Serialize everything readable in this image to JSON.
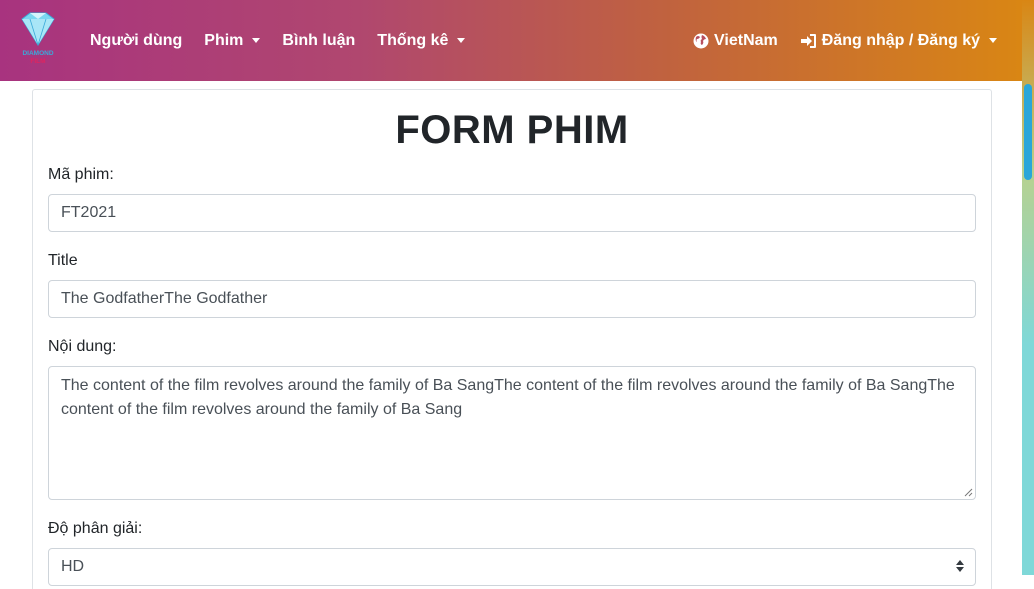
{
  "nav": {
    "logo_text": "DIAMOND FILM",
    "items": [
      {
        "label": "Người dùng",
        "dropdown": false
      },
      {
        "label": "Phim",
        "dropdown": true
      },
      {
        "label": "Bình luận",
        "dropdown": false
      },
      {
        "label": "Thống kê",
        "dropdown": true
      }
    ],
    "language": {
      "label": "VietNam",
      "icon": "globe-icon"
    },
    "auth": {
      "label": "Đăng nhập / Đăng ký",
      "icon": "sign-in-icon",
      "dropdown": true
    }
  },
  "form": {
    "title": "FORM PHIM",
    "movie_id": {
      "label": "Mã phim:",
      "value": "FT2021"
    },
    "movie_title": {
      "label": "Title",
      "value": "The GodfatherThe Godfather"
    },
    "content": {
      "label": "Nội dung:",
      "value": "The content of the film revolves around the family of Ba SangThe content of the film revolves around the family of Ba SangThe content of the film revolves around the family of Ba Sang"
    },
    "resolution": {
      "label": "Độ phân giải:",
      "value": "HD"
    }
  },
  "colors": {
    "navbar_gradient_start": "#a8337f",
    "navbar_gradient_end": "#d98614",
    "scroll_thumb": "#2aa6d9"
  }
}
